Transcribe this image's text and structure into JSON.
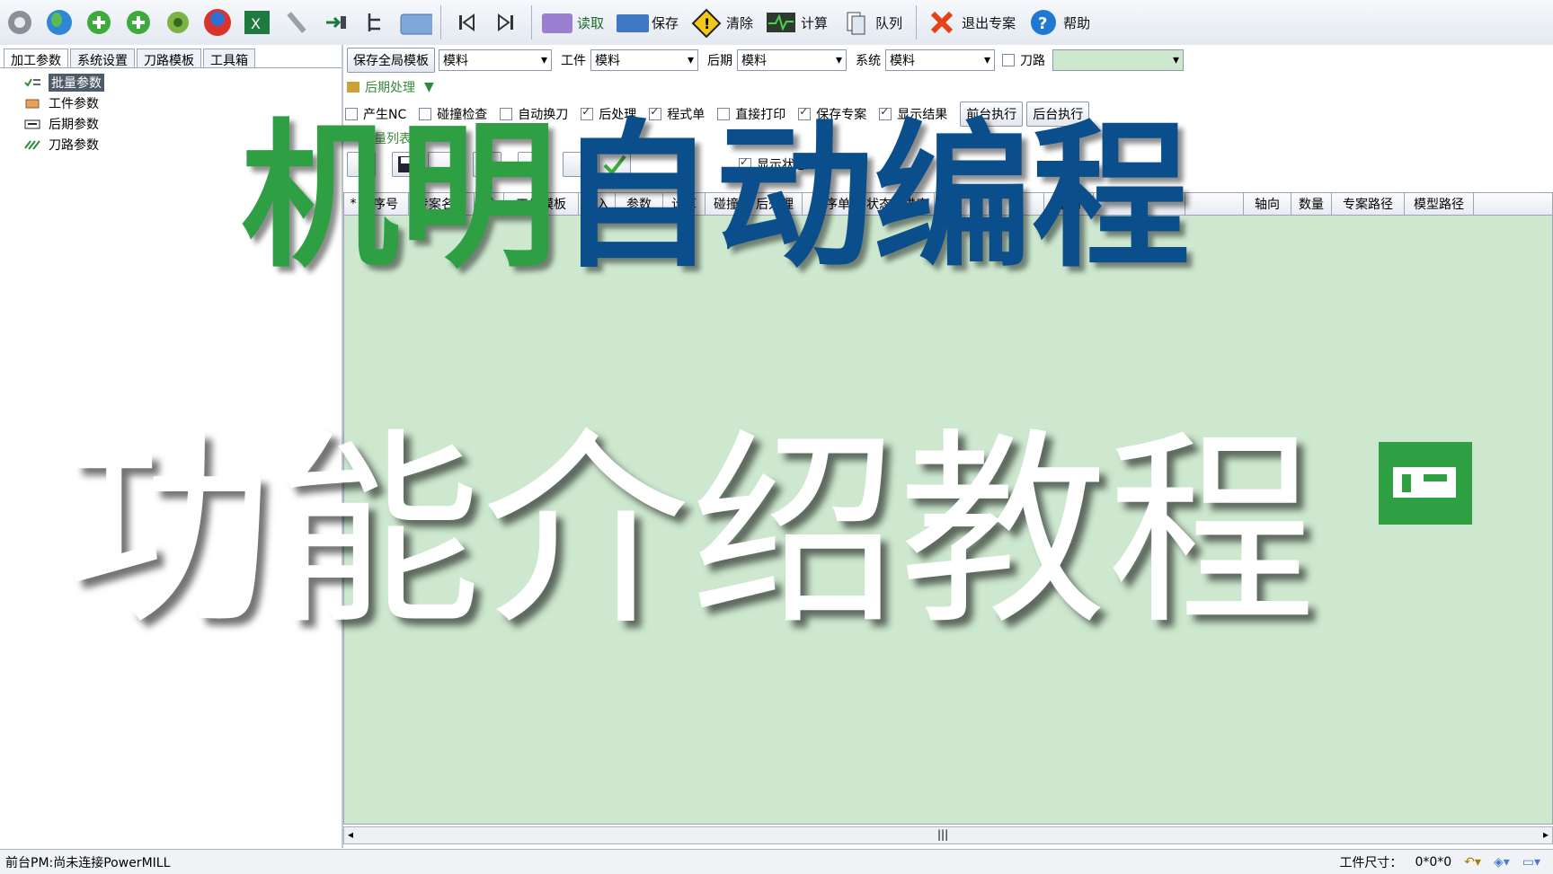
{
  "toolbar": {
    "read_label": "读取",
    "save_label": "保存",
    "clear_label": "清除",
    "calc_label": "计算",
    "queue_label": "队列",
    "exit_label": "退出专案",
    "help_label": "帮助"
  },
  "left_tabs": [
    "加工参数",
    "系统设置",
    "刀路模板",
    "工具箱"
  ],
  "tree": [
    "批量参数",
    "工件参数",
    "后期参数",
    "刀路参数"
  ],
  "row1": {
    "save_template": "保存全局模板",
    "combo1": "模料",
    "workpiece_label": "工件",
    "combo2": "模料",
    "post_label": "后期",
    "combo3": "模料",
    "system_label": "系统",
    "combo4": "模料",
    "toolpath_label": "刀路"
  },
  "post_section": "后期处理",
  "options": [
    {
      "label": "产生NC",
      "checked": false
    },
    {
      "label": "碰撞检查",
      "checked": false
    },
    {
      "label": "自动换刀",
      "checked": false
    },
    {
      "label": "后处理",
      "checked": true
    },
    {
      "label": "程式单",
      "checked": true
    },
    {
      "label": "直接打印",
      "checked": false
    },
    {
      "label": "保存专案",
      "checked": true
    },
    {
      "label": "显示结果",
      "checked": true
    }
  ],
  "front_exec": "前台执行",
  "back_exec": "后台执行",
  "list_label": "量列表",
  "show_status": "显示状态",
  "grid_headers": [
    "*",
    "序号",
    "专案名称",
    "类",
    "工件模板",
    "导入",
    "参数",
    "计算",
    "碰撞",
    "后处理",
    "程序单",
    "状态",
    "进度",
    "",
    "",
    "轴向",
    "",
    "",
    "",
    "轴向",
    "数量",
    "专案路径",
    "模型路径"
  ],
  "status": {
    "left": "前台PM:尚未连接PowerMILL",
    "size_label": "工件尺寸：",
    "size_value": "0*0*0"
  },
  "overlay": {
    "line1_green": "机明",
    "line1_blue": "自动编程",
    "line2": "功能介绍教程"
  },
  "colors": {
    "green": "#2ea043",
    "blue": "#0b4e8c",
    "grid_bg": "#cde8cf"
  }
}
